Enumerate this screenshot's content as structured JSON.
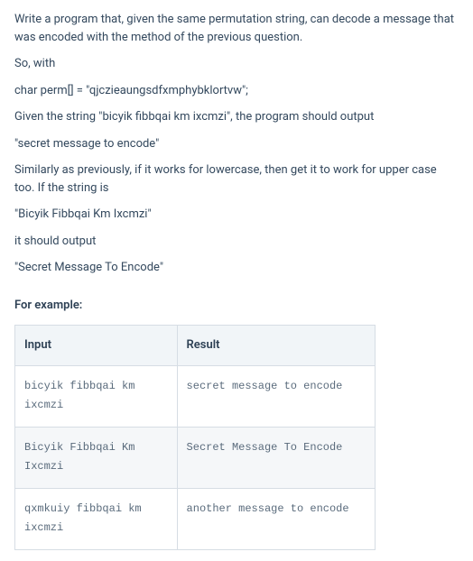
{
  "paragraphs": [
    "Write a program that, given the same permutation string, can decode a message that was encoded with the method of the previous question.",
    "So, with",
    "char perm[] = \"qjczieaungsdfxmphybklortvw\";",
    "Given the string \"bicyik fibbqai km ixcmzi\", the program should output",
    "\"secret message to encode\"",
    "Similarly as previously, if it works for lowercase, then get it to work for upper case too. If the string is",
    "\"Bicyik Fibbqai Km Ixcmzi\"",
    "it should output",
    "\"Secret Message To Encode\""
  ],
  "example_heading": "For example:",
  "table": {
    "headers": [
      "Input",
      "Result"
    ],
    "rows": [
      {
        "input": "bicyik fibbqai km ixcmzi",
        "result": "secret message to encode"
      },
      {
        "input": "Bicyik Fibbqai Km Ixcmzi",
        "result": "Secret Message To Encode"
      },
      {
        "input": "qxmkuiy fibbqai km ixcmzi",
        "result": "another message to encode"
      }
    ]
  }
}
